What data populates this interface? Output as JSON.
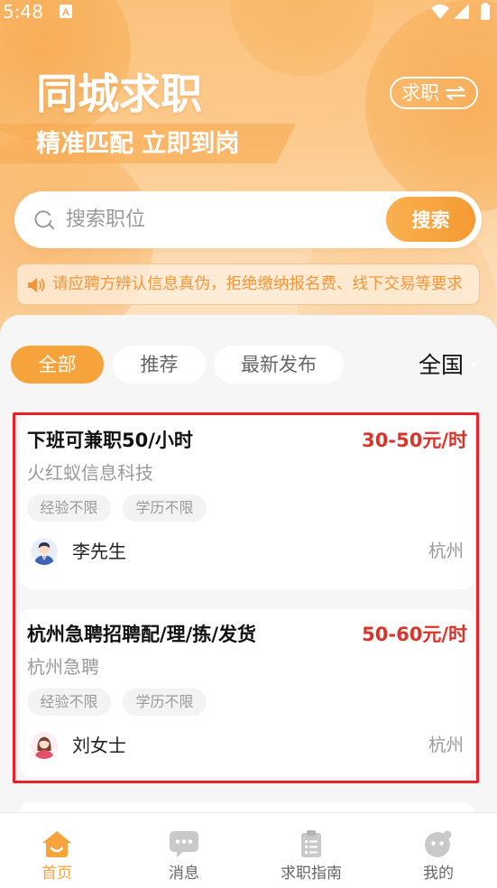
{
  "status_bar": {
    "time": "5:48"
  },
  "header": {
    "title": "同城求职",
    "subtitle": "精准匹配 立即到岗",
    "switch_label": "求职"
  },
  "search": {
    "placeholder": "搜索职位",
    "button_label": "搜索"
  },
  "notice": {
    "text": "请应聘方辨认信息真伪，拒绝缴纳报名费、线下交易等要求"
  },
  "filters": {
    "tabs": [
      {
        "label": "全部",
        "active": true
      },
      {
        "label": "推荐",
        "active": false
      },
      {
        "label": "最新发布",
        "active": false
      }
    ],
    "region": "全国"
  },
  "jobs": [
    {
      "title": "下班可兼职50/小时",
      "salary": "30-50元/时",
      "company": "火红蚁信息科技",
      "tags": [
        "经验不限",
        "学历不限"
      ],
      "contact": "李先生",
      "avatar": "male-avatar-icon",
      "location": "杭州"
    },
    {
      "title": "杭州急聘招聘配/理/拣/发货",
      "salary": "50-60元/时",
      "company": "杭州急聘",
      "tags": [
        "经验不限",
        "学历不限"
      ],
      "contact": "刘女士",
      "avatar": "female-avatar-icon",
      "location": "杭州"
    }
  ],
  "nav": [
    {
      "label": "首页",
      "icon": "home-icon",
      "active": true
    },
    {
      "label": "消息",
      "icon": "message-icon",
      "active": false
    },
    {
      "label": "求职指南",
      "icon": "guide-icon",
      "active": false
    },
    {
      "label": "我的",
      "icon": "profile-icon",
      "active": false
    }
  ],
  "colors": {
    "accent": "#f7a33b",
    "salary": "#d9342b",
    "notice": "#f2963a",
    "frame": "#ea2128"
  }
}
